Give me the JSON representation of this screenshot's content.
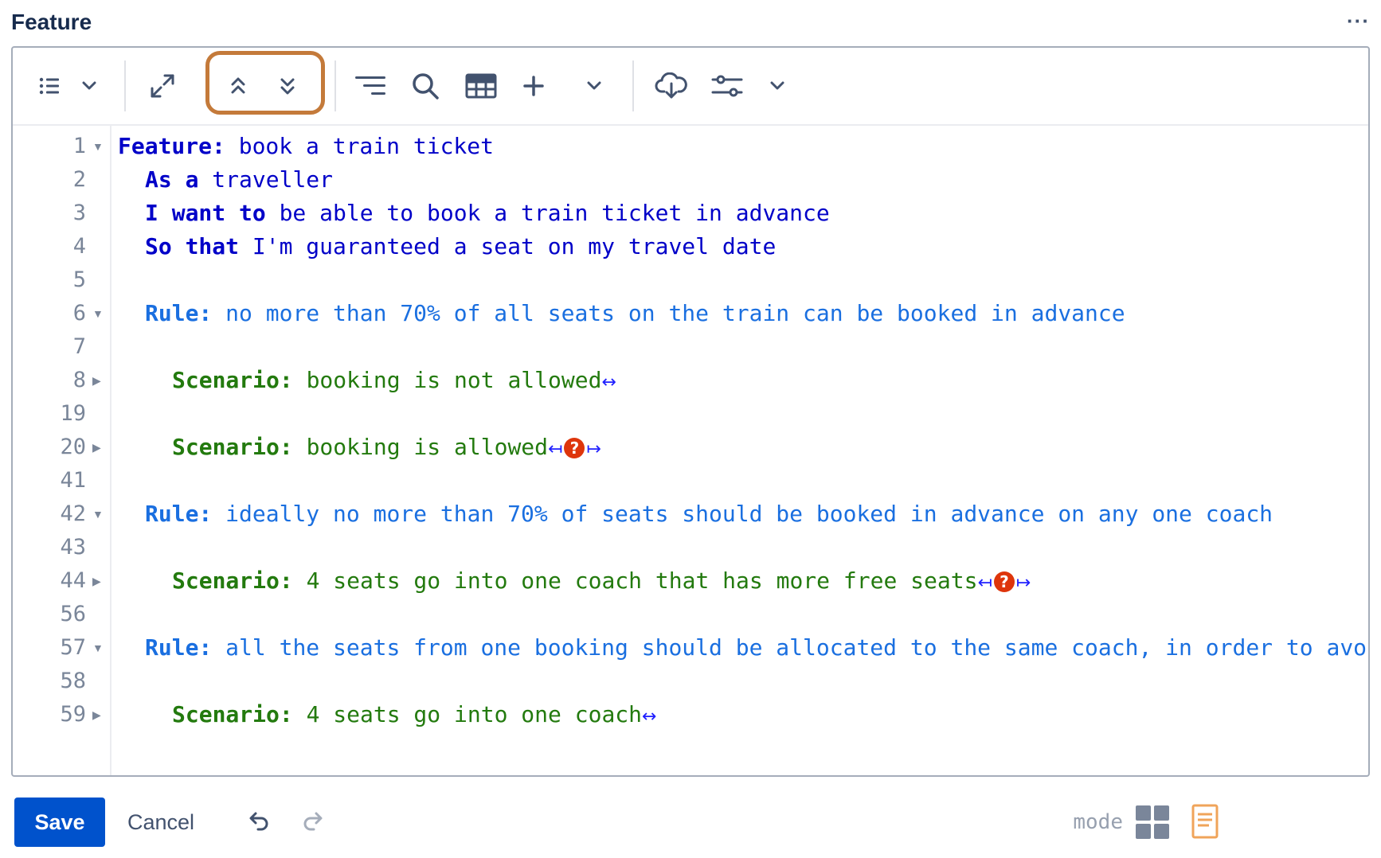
{
  "header": {
    "title": "Feature",
    "more_label": "···"
  },
  "toolbar": {
    "icons": [
      "list-icon",
      "chevron-down-icon",
      "expand-icon",
      "collapse-all-icon",
      "expand-all-icon",
      "outline-icon",
      "search-icon",
      "table-icon",
      "plus-icon",
      "chevron-down-icon",
      "cloud-download-icon",
      "settings-sliders-icon",
      "chevron-down-icon"
    ]
  },
  "editor": {
    "lines": [
      {
        "num": "1",
        "fold": "▼"
      },
      {
        "num": "2",
        "fold": ""
      },
      {
        "num": "3",
        "fold": ""
      },
      {
        "num": "4",
        "fold": ""
      },
      {
        "num": "5",
        "fold": ""
      },
      {
        "num": "6",
        "fold": "▼"
      },
      {
        "num": "7",
        "fold": ""
      },
      {
        "num": "8",
        "fold": "▶"
      },
      {
        "num": "19",
        "fold": ""
      },
      {
        "num": "20",
        "fold": "▶"
      },
      {
        "num": "41",
        "fold": ""
      },
      {
        "num": "42",
        "fold": "▼"
      },
      {
        "num": "43",
        "fold": ""
      },
      {
        "num": "44",
        "fold": "▶"
      },
      {
        "num": "56",
        "fold": ""
      },
      {
        "num": "57",
        "fold": "▼"
      },
      {
        "num": "58",
        "fold": ""
      },
      {
        "num": "59",
        "fold": "▶"
      }
    ],
    "feature_keyword": "Feature:",
    "feature_text": " book a train ticket",
    "as_a_keyword": "As a",
    "as_a_text": " traveller",
    "i_want_keyword": "I want to",
    "i_want_text": " be able to book a train ticket in advance",
    "so_that_keyword": "So that",
    "so_that_text": " I'm guaranteed a seat on my travel date",
    "rule_keyword": "Rule:",
    "scenario_keyword": "Scenario:",
    "rule1_text": " no more than 70% of all seats on the train can be booked in advance",
    "scenario1_text": " booking is not allowed",
    "scenario2_text": " booking is allowed",
    "rule2_text": " ideally no more than 70% of seats should be booked in advance on any one coach",
    "scenario3_text": " 4 seats go into one coach that has more free seats",
    "rule3_text": " all the seats from one booking should be allocated to the same coach, in order to avo",
    "scenario4_text": " 4 seats go into one coach",
    "collapsed_marker": "↔",
    "left_marker": "↤",
    "right_marker": "↦",
    "warning_marker": "?"
  },
  "footer": {
    "save_label": "Save",
    "cancel_label": "Cancel",
    "mode_label": "mode"
  },
  "colors": {
    "primary": "#0052cc",
    "highlight": "#c47a3a",
    "feature_blue": "#0000c8",
    "rule_blue": "#1a6fe0",
    "scenario_green": "#237a0e",
    "warning_red": "#de350b",
    "doc_orange": "#f0a45a"
  }
}
